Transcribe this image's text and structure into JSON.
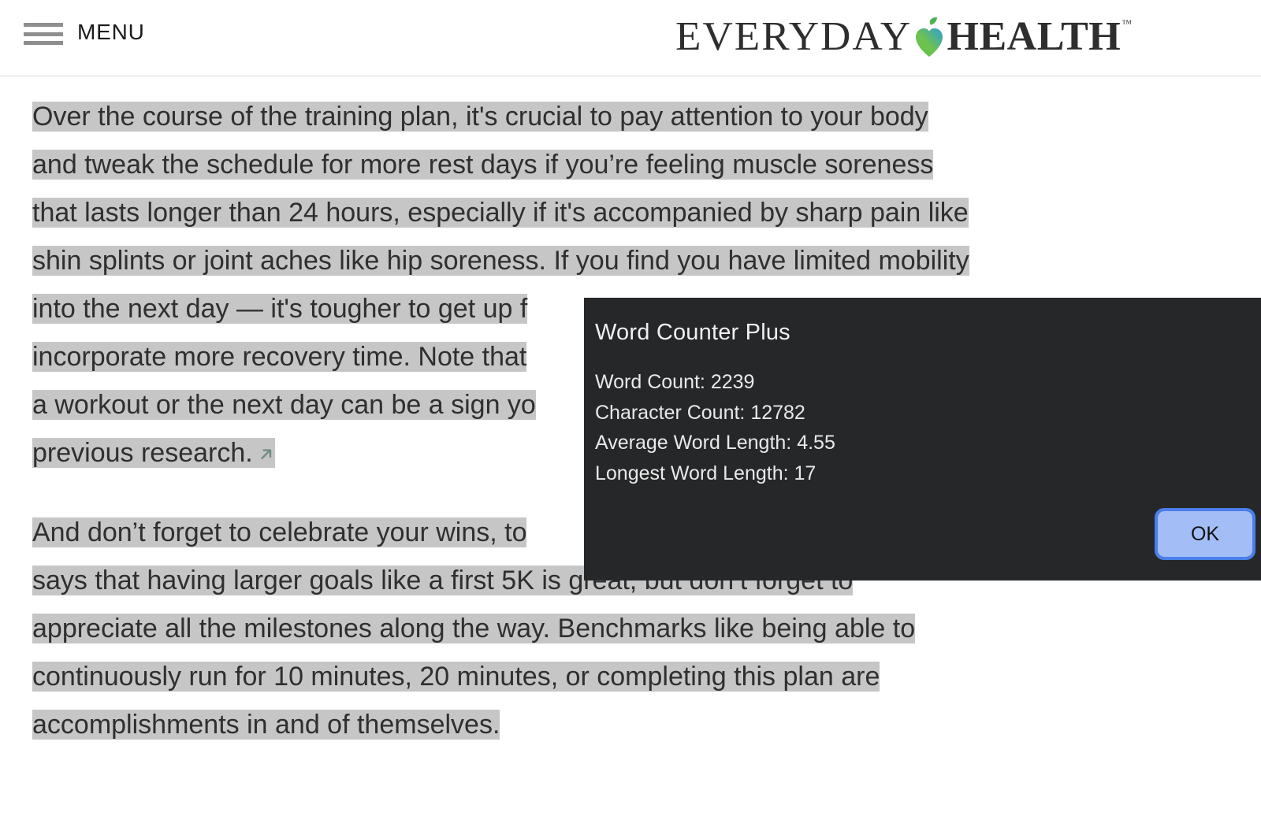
{
  "header": {
    "menu_label": "MENU",
    "menu_icon": "hamburger-icon",
    "brand": {
      "word_light": "EVERYDAY",
      "word_bold": "HEALTH",
      "trademark": "™",
      "mark_icon": "heart-leaf-icon",
      "mark_gradient_from": "#6cc24a",
      "mark_gradient_to": "#3aa0d8"
    },
    "border_color": "#d8d8d8"
  },
  "article": {
    "selection_highlight_color": "#c6c6c6",
    "text_color": "#2f2f2f",
    "paragraphs": [
      {
        "id": "paragraph-1",
        "lines": [
          "Over the course of the training plan, it's crucial to pay attention to your body",
          "and tweak the schedule for more rest days if you’re feeling muscle soreness",
          "that lasts longer than 24 hours, especially if it's accompanied by sharp pain like",
          "shin splints or joint aches like hip soreness. If you find you have limited mobility",
          "into the next day — it's tougher to get up f",
          "incorporate more recovery time. Note that",
          "a workout or the next day can be a sign yo",
          "previous research."
        ],
        "external_link_icon": "external-link-arrow-icon",
        "external_link_icon_color": "#6d8d84"
      },
      {
        "id": "paragraph-2",
        "lines": [
          "And don’t forget to celebrate your wins, to",
          "says that having larger goals like a first 5K is great, but don’t forget to",
          "appreciate all the milestones along the way. Benchmarks like being able to",
          "continuously run for 10 minutes, 20 minutes, or completing this plan are",
          "accomplishments in and of themselves."
        ]
      }
    ]
  },
  "dialog": {
    "title": "Word Counter Plus",
    "background": "#262729",
    "stats": [
      "Word Count: 2239",
      "Character Count: 12782",
      "Average Word Length: 4.55",
      "Longest Word Length: 17"
    ],
    "metrics": {
      "word_count": 2239,
      "character_count": 12782,
      "average_word_length": 4.55,
      "longest_word_length": 17
    },
    "ok_label": "OK",
    "ok_fill": "#a3bdf7",
    "ok_focus_ring": "#4a7fe8"
  }
}
